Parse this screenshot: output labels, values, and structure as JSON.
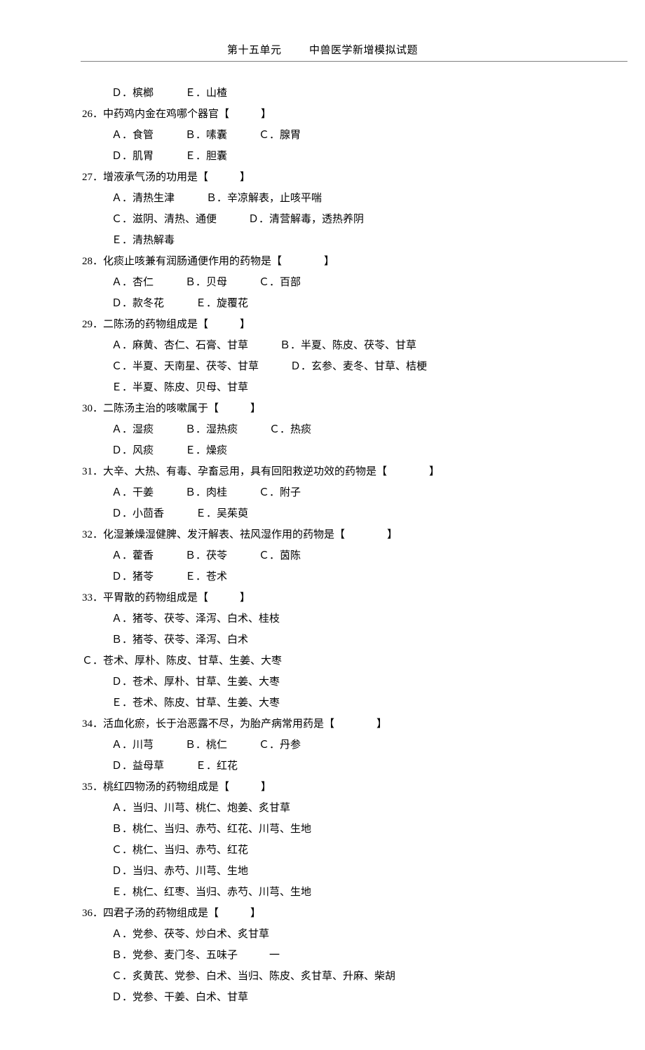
{
  "header": {
    "unit": "第十五单元",
    "title": "中兽医学新增模拟试题"
  },
  "q25_opts_de": "Ｄ．槟榔　　　Ｅ．山楂",
  "q26_stem": "26．中药鸡内金在鸡哪个器官【　　　】",
  "q26_opts_abc": "Ａ．食管　　　Ｂ．嗉囊　　　Ｃ．腺胃",
  "q26_opts_de": "Ｄ．肌胃　　　Ｅ．胆囊",
  "q27_stem": "27．增液承气汤的功用是【　　　】",
  "q27_opt_ab": "Ａ．清热生津　　　Ｂ．辛凉解表，止咳平喘",
  "q27_opt_cd": "Ｃ．滋阴、清热、通便　　　Ｄ．清营解毒，透热养阴",
  "q27_opt_e": "Ｅ．清热解毒",
  "q28_stem": "28．化痰止咳兼有润肠通便作用的药物是【　　　　】",
  "q28_opts_abc": "Ａ．杏仁　　　Ｂ．贝母　　　Ｃ．百部",
  "q28_opts_de": "Ｄ．款冬花　　　Ｅ．旋覆花",
  "q29_stem": "29．二陈汤的药物组成是【　　　】",
  "q29_opt_ab": "Ａ．麻黄、杏仁、石膏、甘草　　　Ｂ．半夏、陈皮、茯苓、甘草",
  "q29_opt_cd": "Ｃ．半夏、天南星、茯苓、甘草　　　Ｄ．玄参、麦冬、甘草、桔梗",
  "q29_opt_e": "Ｅ．半夏、陈皮、贝母、甘草",
  "q30_stem": "30．二陈汤主治的咳嗽属于【　　　】",
  "q30_opts_abc": "Ａ．湿痰　　　Ｂ．湿热痰　　　Ｃ．热痰",
  "q30_opts_de": "Ｄ．风痰　　　Ｅ．燥痰",
  "q31_stem": "31．大辛、大热、有毒、孕畜忌用，具有回阳救逆功效的药物是【　　　　】",
  "q31_opts_abc": "Ａ．干姜　　　Ｂ．肉桂　　　Ｃ．附子",
  "q31_opts_de": "Ｄ．小茴香　　　Ｅ．吴茱萸",
  "q32_stem": "32．化湿兼燥湿健脾、发汗解表、祛风湿作用的药物是【　　　　】",
  "q32_opts_abc": "Ａ．藿香　　　Ｂ．茯苓　　　Ｃ．茵陈",
  "q32_opts_de": "Ｄ．猪苓　　　Ｅ．苍术",
  "q33_stem": "33．平胃散的药物组成是【　　　】",
  "q33_opt_a": "Ａ．猪苓、茯苓、泽泻、白术、桂枝",
  "q33_opt_b": "Ｂ．猪苓、茯苓、泽泻、白术",
  "q33_opt_c": "Ｃ．苍术、厚朴、陈皮、甘草、生姜、大枣",
  "q33_opt_d": "Ｄ．苍术、厚朴、甘草、生姜、大枣",
  "q33_opt_e": "Ｅ．苍术、陈皮、甘草、生姜、大枣",
  "q34_stem": "34．活血化瘀，长于治恶露不尽，为胎产病常用药是【　　　　】",
  "q34_opts_abc": "Ａ．川芎　　　Ｂ．桃仁　　　Ｃ．丹参",
  "q34_opts_de": "Ｄ．益母草　　　Ｅ．红花",
  "q35_stem": "35．桃红四物汤的药物组成是【　　　】",
  "q35_opt_a": "Ａ．当归、川芎、桃仁、炮姜、炙甘草",
  "q35_opt_b": "Ｂ．桃仁、当归、赤芍、红花、川芎、生地",
  "q35_opt_c": "Ｃ．桃仁、当归、赤芍、红花",
  "q35_opt_d": "Ｄ．当归、赤芍、川芎、生地",
  "q35_opt_e": "Ｅ．桃仁、红枣、当归、赤芍、川芎、生地",
  "q36_stem": "36．四君子汤的药物组成是【　　　】",
  "q36_opt_a": "Ａ．党参、茯苓、炒白术、炙甘草",
  "q36_opt_b": "Ｂ．党参、麦门冬、五味子　　　一",
  "q36_opt_c": "Ｃ．炙黄芪、党参、白术、当归、陈皮、炙甘草、升麻、柴胡",
  "q36_opt_d": "Ｄ．党参、干姜、白术、甘草"
}
